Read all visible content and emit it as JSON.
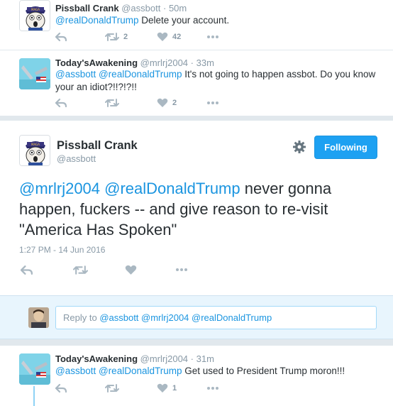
{
  "tweet1": {
    "name": "Pissball Crank",
    "handle": "@assbott",
    "time": "50m",
    "mention": "@realDonaldTrump",
    "text": " Delete your account.",
    "retweets": "2",
    "likes": "42"
  },
  "tweet2": {
    "name": "Today'sAwakening",
    "handle": "@mrlrj2004",
    "time": "33m",
    "mentions": "@assbott @realDonaldTrump",
    "text": " It's not going to happen assbot. Do you know your an idiot?!!?!?!!",
    "likes": "2"
  },
  "focused": {
    "name": "Pissball Crank",
    "handle": "@assbott",
    "follow_label": "Following",
    "mentions": "@mrlrj2004 @realDonaldTrump",
    "text": " never gonna happen, fuckers -- and give reason to re-visit \"America Has Spoken\"",
    "timestamp": "1:27 PM - 14 Jun 2016"
  },
  "reply": {
    "prefix": "Reply to ",
    "mentions": "@assbott @mrlrj2004 @realDonaldTrump"
  },
  "tweet3": {
    "name": "Today'sAwakening",
    "handle": "@mrlrj2004",
    "time": "31m",
    "mentions": "@assbott @realDonaldTrump",
    "text": " Get used to President Trump moron!!!",
    "likes": "1"
  },
  "colors": {
    "link": "#1b95e0",
    "follow_button": "#1da1f2",
    "muted": "#8899a6",
    "icon": "#aab8c2"
  },
  "icons": [
    "reply-icon",
    "retweet-icon",
    "like-icon",
    "more-icon",
    "gear-icon"
  ]
}
